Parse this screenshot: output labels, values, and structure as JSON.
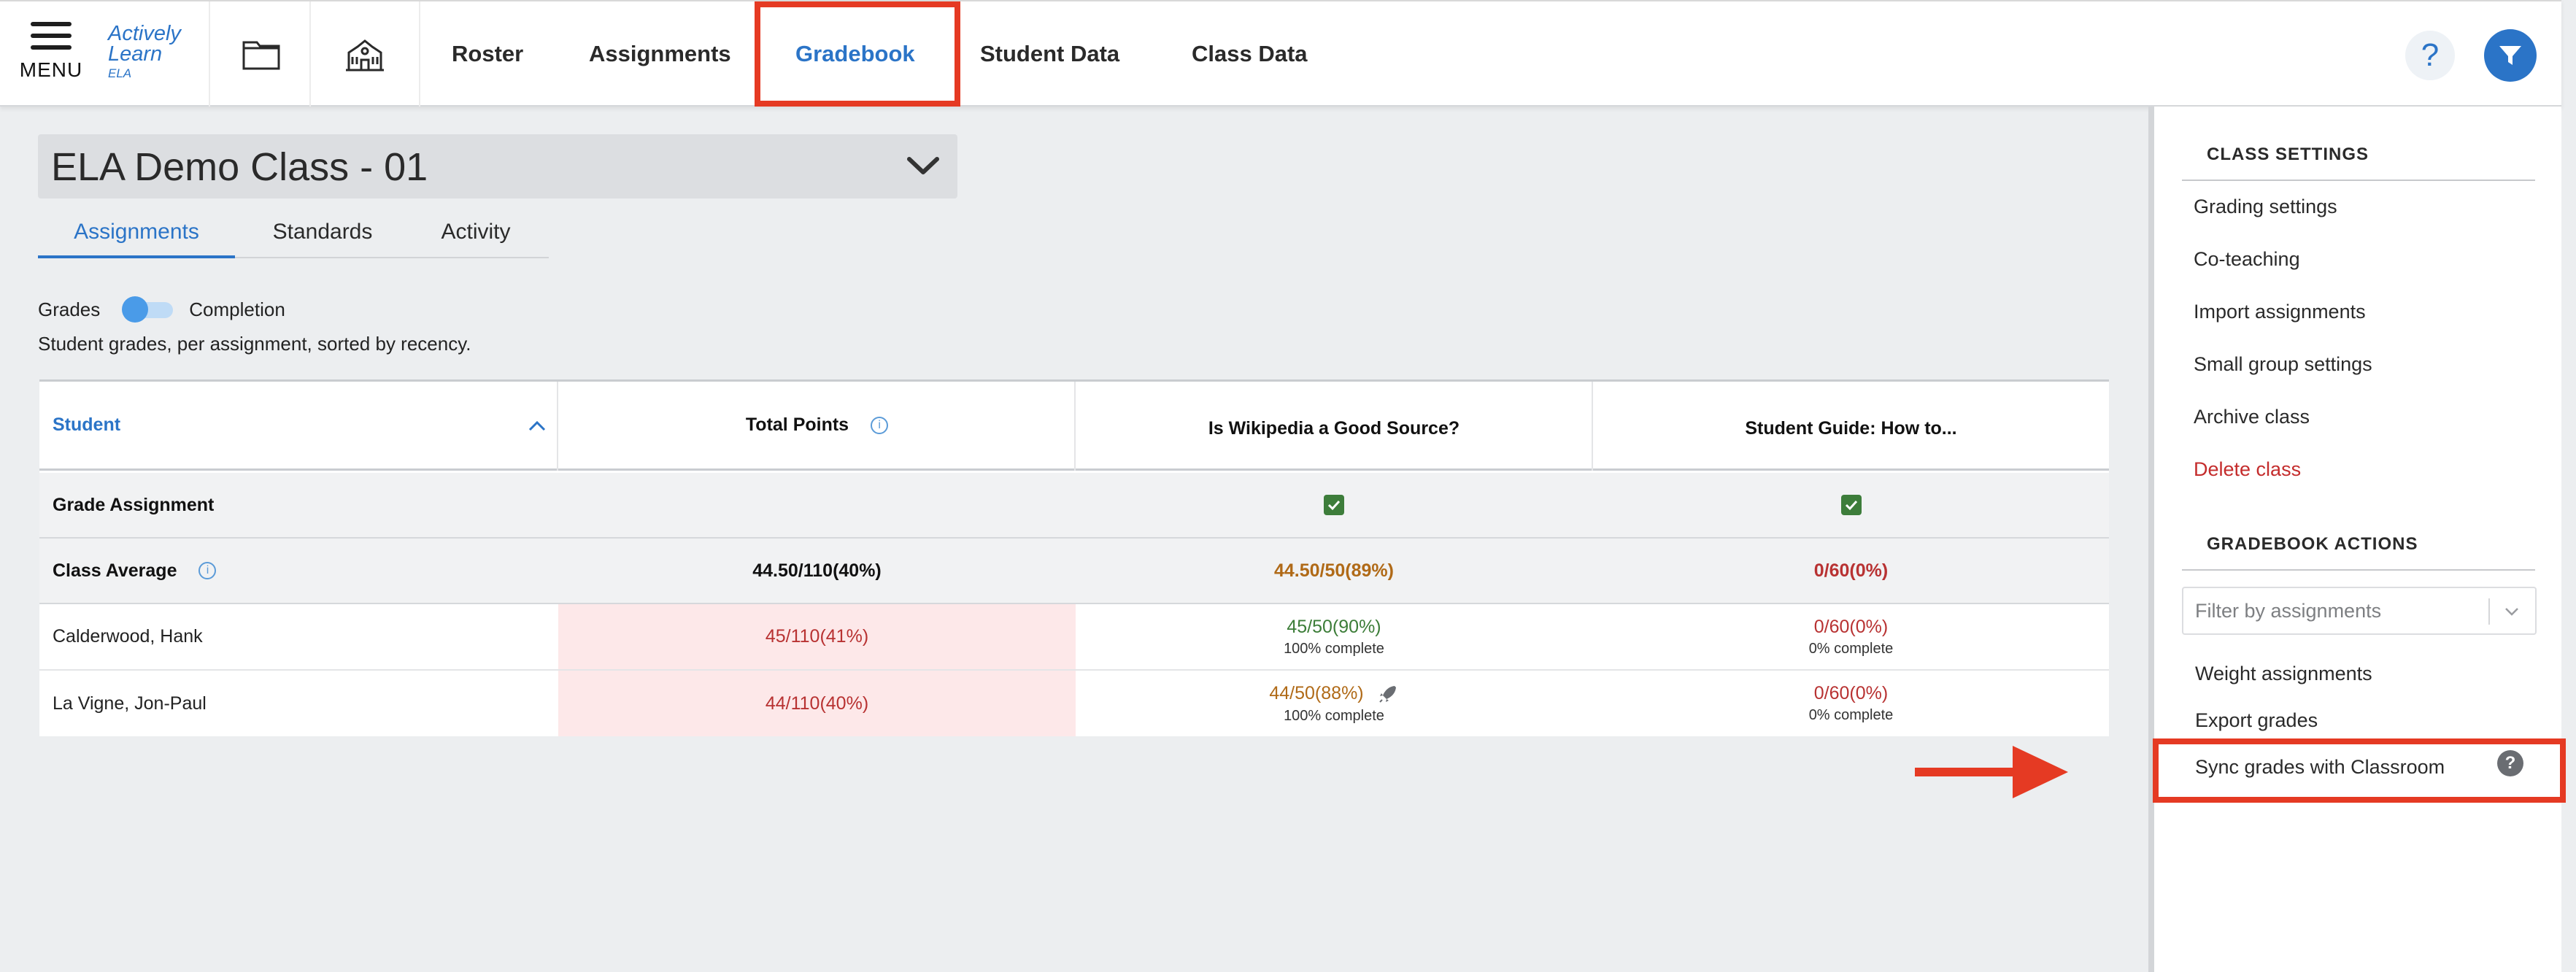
{
  "app": {
    "menu_label": "MENU",
    "logo_line1": "Actively",
    "logo_line2": "Learn",
    "logo_sub": "ELA"
  },
  "nav": {
    "icons": [
      "folder-icon",
      "school-building-icon"
    ],
    "tabs": [
      {
        "label": "Roster"
      },
      {
        "label": "Assignments"
      },
      {
        "label": "Gradebook",
        "active": true
      },
      {
        "label": "Student Data"
      },
      {
        "label": "Class Data"
      }
    ],
    "help_label": "?"
  },
  "class_select": {
    "value": "ELA Demo Class - 01"
  },
  "subtabs": [
    {
      "label": "Assignments",
      "active": true
    },
    {
      "label": "Standards"
    },
    {
      "label": "Activity"
    }
  ],
  "toggle": {
    "left_label": "Grades",
    "right_label": "Completion"
  },
  "description": "Student grades, per assignment, sorted by recency.",
  "table": {
    "headers": [
      "Student",
      "Total Points",
      "Is Wikipedia a Good Source?",
      "Student Guide: How to..."
    ],
    "grade_row": {
      "label": "Grade Assignment"
    },
    "average_row": {
      "label": "Class Average",
      "total": "44.50/110(40%)",
      "a1": "44.50/50(89%)",
      "a2": "0/60(0%)"
    },
    "students": [
      {
        "name": "Calderwood, Hank",
        "total": "45/110(41%)",
        "a1": "45/50(90%)",
        "a1_completion": "100% complete",
        "a2": "0/60(0%)",
        "a2_completion": "0% complete"
      },
      {
        "name": "La Vigne, Jon-Paul",
        "total": "44/110(40%)",
        "a1": "44/50(88%)",
        "a1_completion": "100% complete",
        "a2": "0/60(0%)",
        "a2_completion": "0% complete"
      }
    ]
  },
  "side_panel": {
    "class_settings_title": "CLASS SETTINGS",
    "class_settings": [
      "Grading settings",
      "Co-teaching",
      "Import assignments",
      "Small group settings",
      "Archive class",
      "Delete class"
    ],
    "gradebook_actions_title": "GRADEBOOK ACTIONS",
    "filter_placeholder": "Filter by assignments",
    "actions": [
      "Weight assignments",
      "Export grades",
      "Sync grades with Classroom"
    ],
    "help_badge": "?"
  },
  "colors": {
    "accent": "#2b74c7",
    "annotation": "#e53a23",
    "danger": "#c42c2c",
    "low_score": "#b83232",
    "mid_score": "#b06a17",
    "high_score": "#3c7d38"
  }
}
